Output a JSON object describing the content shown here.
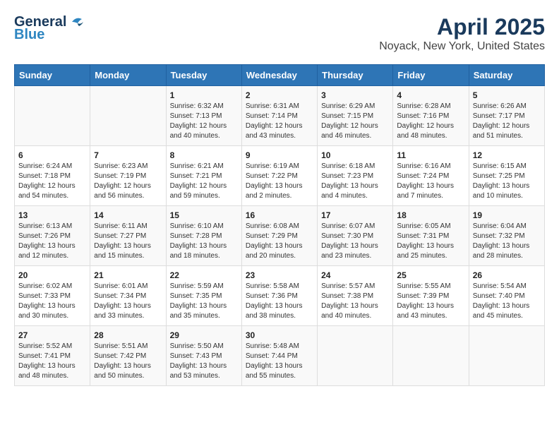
{
  "header": {
    "logo_line1": "General",
    "logo_line2": "Blue",
    "title": "April 2025",
    "subtitle": "Noyack, New York, United States"
  },
  "days_of_week": [
    "Sunday",
    "Monday",
    "Tuesday",
    "Wednesday",
    "Thursday",
    "Friday",
    "Saturday"
  ],
  "weeks": [
    [
      {
        "day": "",
        "content": ""
      },
      {
        "day": "",
        "content": ""
      },
      {
        "day": "1",
        "content": "Sunrise: 6:32 AM\nSunset: 7:13 PM\nDaylight: 12 hours and 40 minutes."
      },
      {
        "day": "2",
        "content": "Sunrise: 6:31 AM\nSunset: 7:14 PM\nDaylight: 12 hours and 43 minutes."
      },
      {
        "day": "3",
        "content": "Sunrise: 6:29 AM\nSunset: 7:15 PM\nDaylight: 12 hours and 46 minutes."
      },
      {
        "day": "4",
        "content": "Sunrise: 6:28 AM\nSunset: 7:16 PM\nDaylight: 12 hours and 48 minutes."
      },
      {
        "day": "5",
        "content": "Sunrise: 6:26 AM\nSunset: 7:17 PM\nDaylight: 12 hours and 51 minutes."
      }
    ],
    [
      {
        "day": "6",
        "content": "Sunrise: 6:24 AM\nSunset: 7:18 PM\nDaylight: 12 hours and 54 minutes."
      },
      {
        "day": "7",
        "content": "Sunrise: 6:23 AM\nSunset: 7:19 PM\nDaylight: 12 hours and 56 minutes."
      },
      {
        "day": "8",
        "content": "Sunrise: 6:21 AM\nSunset: 7:21 PM\nDaylight: 12 hours and 59 minutes."
      },
      {
        "day": "9",
        "content": "Sunrise: 6:19 AM\nSunset: 7:22 PM\nDaylight: 13 hours and 2 minutes."
      },
      {
        "day": "10",
        "content": "Sunrise: 6:18 AM\nSunset: 7:23 PM\nDaylight: 13 hours and 4 minutes."
      },
      {
        "day": "11",
        "content": "Sunrise: 6:16 AM\nSunset: 7:24 PM\nDaylight: 13 hours and 7 minutes."
      },
      {
        "day": "12",
        "content": "Sunrise: 6:15 AM\nSunset: 7:25 PM\nDaylight: 13 hours and 10 minutes."
      }
    ],
    [
      {
        "day": "13",
        "content": "Sunrise: 6:13 AM\nSunset: 7:26 PM\nDaylight: 13 hours and 12 minutes."
      },
      {
        "day": "14",
        "content": "Sunrise: 6:11 AM\nSunset: 7:27 PM\nDaylight: 13 hours and 15 minutes."
      },
      {
        "day": "15",
        "content": "Sunrise: 6:10 AM\nSunset: 7:28 PM\nDaylight: 13 hours and 18 minutes."
      },
      {
        "day": "16",
        "content": "Sunrise: 6:08 AM\nSunset: 7:29 PM\nDaylight: 13 hours and 20 minutes."
      },
      {
        "day": "17",
        "content": "Sunrise: 6:07 AM\nSunset: 7:30 PM\nDaylight: 13 hours and 23 minutes."
      },
      {
        "day": "18",
        "content": "Sunrise: 6:05 AM\nSunset: 7:31 PM\nDaylight: 13 hours and 25 minutes."
      },
      {
        "day": "19",
        "content": "Sunrise: 6:04 AM\nSunset: 7:32 PM\nDaylight: 13 hours and 28 minutes."
      }
    ],
    [
      {
        "day": "20",
        "content": "Sunrise: 6:02 AM\nSunset: 7:33 PM\nDaylight: 13 hours and 30 minutes."
      },
      {
        "day": "21",
        "content": "Sunrise: 6:01 AM\nSunset: 7:34 PM\nDaylight: 13 hours and 33 minutes."
      },
      {
        "day": "22",
        "content": "Sunrise: 5:59 AM\nSunset: 7:35 PM\nDaylight: 13 hours and 35 minutes."
      },
      {
        "day": "23",
        "content": "Sunrise: 5:58 AM\nSunset: 7:36 PM\nDaylight: 13 hours and 38 minutes."
      },
      {
        "day": "24",
        "content": "Sunrise: 5:57 AM\nSunset: 7:38 PM\nDaylight: 13 hours and 40 minutes."
      },
      {
        "day": "25",
        "content": "Sunrise: 5:55 AM\nSunset: 7:39 PM\nDaylight: 13 hours and 43 minutes."
      },
      {
        "day": "26",
        "content": "Sunrise: 5:54 AM\nSunset: 7:40 PM\nDaylight: 13 hours and 45 minutes."
      }
    ],
    [
      {
        "day": "27",
        "content": "Sunrise: 5:52 AM\nSunset: 7:41 PM\nDaylight: 13 hours and 48 minutes."
      },
      {
        "day": "28",
        "content": "Sunrise: 5:51 AM\nSunset: 7:42 PM\nDaylight: 13 hours and 50 minutes."
      },
      {
        "day": "29",
        "content": "Sunrise: 5:50 AM\nSunset: 7:43 PM\nDaylight: 13 hours and 53 minutes."
      },
      {
        "day": "30",
        "content": "Sunrise: 5:48 AM\nSunset: 7:44 PM\nDaylight: 13 hours and 55 minutes."
      },
      {
        "day": "",
        "content": ""
      },
      {
        "day": "",
        "content": ""
      },
      {
        "day": "",
        "content": ""
      }
    ]
  ]
}
